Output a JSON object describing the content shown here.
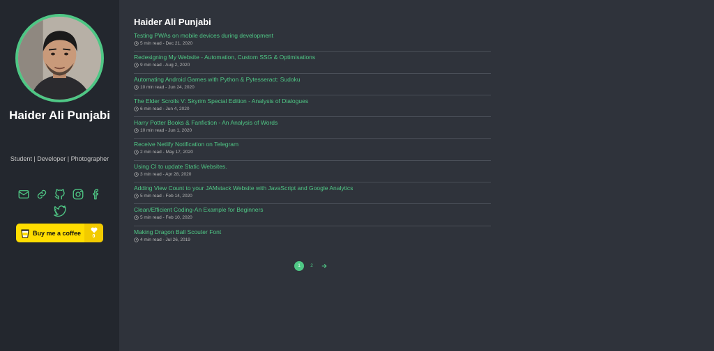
{
  "profile": {
    "name": "Haider Ali Punjabi",
    "tagline": "Student | Developer | Photographer"
  },
  "socials": [
    {
      "icon": "mail-icon"
    },
    {
      "icon": "link-icon"
    },
    {
      "icon": "github-icon"
    },
    {
      "icon": "instagram-icon"
    },
    {
      "icon": "facebook-icon"
    },
    {
      "icon": "twitter-icon"
    }
  ],
  "coffee": {
    "label": "Buy me a coffee",
    "count": "0"
  },
  "main": {
    "title": "Haider Ali Punjabi"
  },
  "posts": [
    {
      "title": "Testing PWAs on mobile devices during development",
      "meta": "5 min read - Dec 21, 2020"
    },
    {
      "title": "Redesigning My Website - Automation, Custom SSG & Optimisations",
      "meta": "9 min read - Aug 2, 2020"
    },
    {
      "title": "Automating Android Games with Python & Pytesseract: Sudoku",
      "meta": "10 min read - Jun 24, 2020"
    },
    {
      "title": "The Elder Scrolls V: Skyrim Special Edition - Analysis of Dialogues",
      "meta": "6 min read - Jun 4, 2020"
    },
    {
      "title": "Harry Potter Books & Fanfiction - An Analysis of Words",
      "meta": "10 min read - Jun 1, 2020"
    },
    {
      "title": "Receive Netlify Notification on Telegram",
      "meta": "2 min read - May 17, 2020"
    },
    {
      "title": "Using CI to update Static Websites.",
      "meta": "3 min read - Apr 28, 2020"
    },
    {
      "title": "Adding View Count to your JAMstack Website with JavaScript and Google Analytics",
      "meta": "5 min read - Feb 14, 2020"
    },
    {
      "title": "Clean/Efficient Coding-An Example for Beginners",
      "meta": "5 min read - Feb 10, 2020"
    },
    {
      "title": "Making Dragon Ball Scouter Font",
      "meta": "4 min read - Jul 26, 2019"
    }
  ],
  "pagination": {
    "pages": [
      "1",
      "2"
    ],
    "current": "1",
    "next_icon": "arrow-right-icon"
  },
  "colors": {
    "accent": "#4fc785",
    "sidebar_bg": "#23272e",
    "main_bg": "#2f333b",
    "coffee_yellow": "#ffdd00"
  }
}
